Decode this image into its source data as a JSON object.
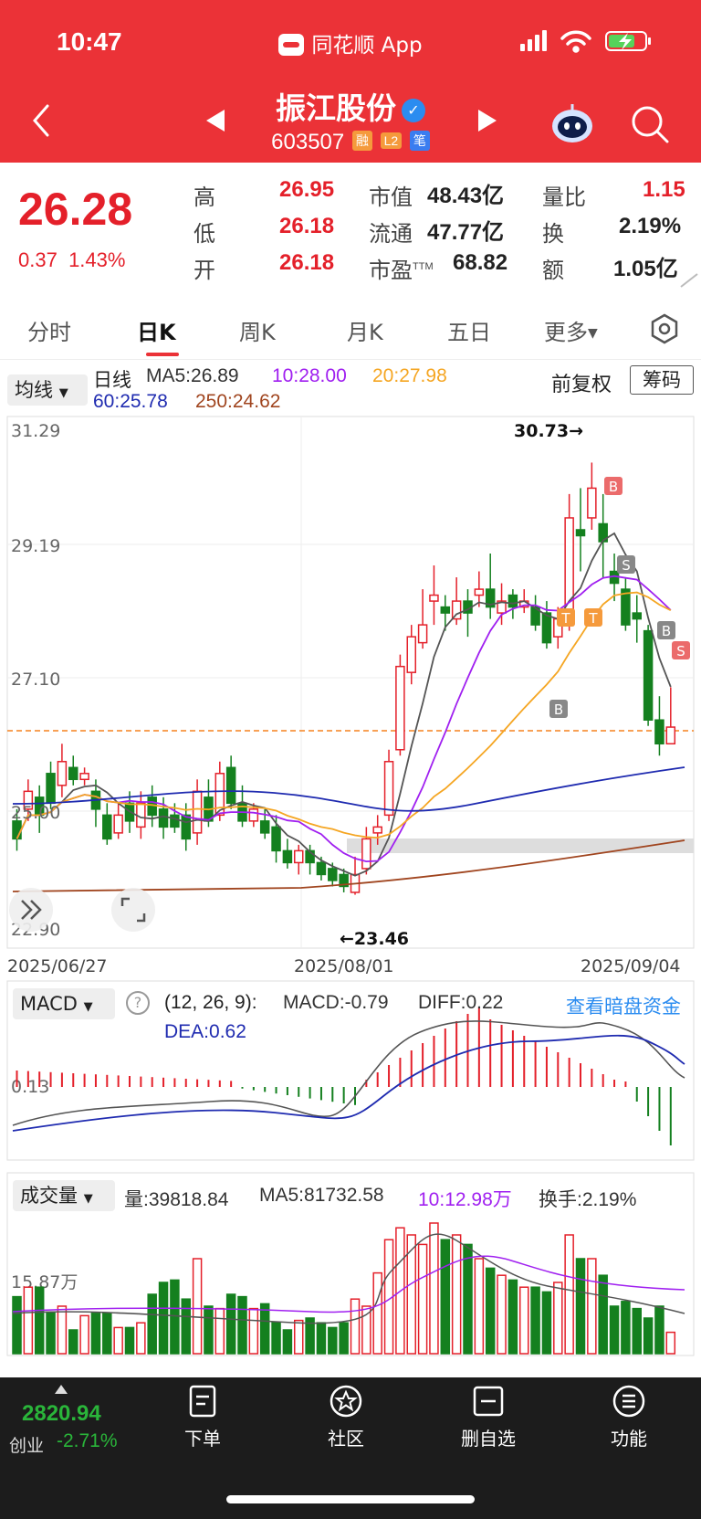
{
  "status": {
    "time": "10:47",
    "app": "同花顺 App"
  },
  "header": {
    "title": "振江股份",
    "code": "603507",
    "badges": [
      "融",
      "L2",
      "笔"
    ]
  },
  "quote": {
    "price": "26.28",
    "change": "0.37",
    "change_pct": "1.43%",
    "rows": [
      {
        "l1": "高",
        "v1": "26.95",
        "l2": "市值",
        "v2": "48.43亿",
        "l3": "量比",
        "v3": "1.15"
      },
      {
        "l1": "低",
        "v1": "26.18",
        "l2": "流通",
        "v2": "47.77亿",
        "l3": "换",
        "v3": "2.19%"
      },
      {
        "l1": "开",
        "v1": "26.18",
        "l2": "市盈",
        "l2sup": "TTM",
        "v2": "68.82",
        "l3": "额",
        "v3": "1.05亿"
      }
    ]
  },
  "tabs": [
    "分时",
    "日K",
    "周K",
    "月K",
    "五日",
    "更多"
  ],
  "ma": {
    "selector": "均线",
    "line": "日线",
    "ma5": "MA5:26.89",
    "ma10": "10:28.00",
    "ma20": "20:27.98",
    "ma60": "60:25.78",
    "ma250": "250:24.62",
    "adjust": "前复权",
    "chips": "筹码"
  },
  "kline": {
    "y_labels": [
      "31.29",
      "29.19",
      "27.10",
      "25.00",
      "22.90"
    ],
    "high_mark": "30.73→",
    "low_mark": "←23.46",
    "dates": [
      "2025/06/27",
      "2025/08/01",
      "2025/09/04"
    ],
    "signals": [
      "B",
      "S",
      "B",
      "B",
      "T",
      "T",
      "S"
    ]
  },
  "macd": {
    "selector": "MACD",
    "params": "(12, 26, 9):",
    "macd": "MACD:-0.79",
    "diff": "DIFF:0.22",
    "dea": "DEA:0.62",
    "link": "查看暗盘资金",
    "y_label": "0.13"
  },
  "volume": {
    "selector": "成交量",
    "vol": "量:39818.84",
    "ma5": "MA5:81732.58",
    "ma10": "10:12.98万",
    "turnover": "换手:2.19%",
    "y_label": "15.87万"
  },
  "bottom": {
    "index_value": "2820.94",
    "index_name": "创业",
    "index_change": "-2.71%",
    "items": [
      "下单",
      "社区",
      "删自选",
      "功能"
    ]
  },
  "colors": {
    "up": "#e4202a",
    "down": "#14801f",
    "header": "#eb3237"
  }
}
